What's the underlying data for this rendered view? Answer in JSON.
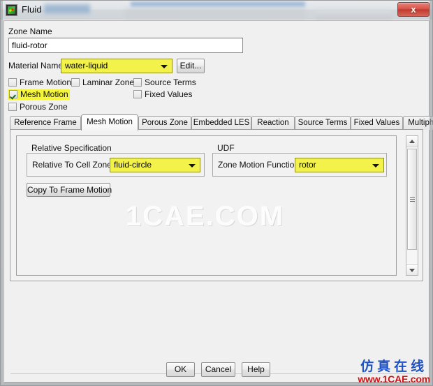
{
  "window": {
    "title": "Fluid",
    "icon": "fluent-app-icon",
    "close_label": "x"
  },
  "form": {
    "zone_name_label": "Zone Name",
    "zone_name_value": "fluid-rotor",
    "material_name_label": "Material Name",
    "material_name_value": "water-liquid",
    "edit_button": "Edit..."
  },
  "checkboxes": [
    {
      "label": "Frame Motion",
      "checked": false,
      "highlighted": false
    },
    {
      "label": "Laminar Zone",
      "checked": false,
      "highlighted": false
    },
    {
      "label": "Source Terms",
      "checked": false,
      "highlighted": false
    },
    {
      "label": "Mesh Motion",
      "checked": true,
      "highlighted": true
    },
    {
      "label": "Fixed Values",
      "checked": false,
      "highlighted": false
    },
    {
      "label": "Porous Zone",
      "checked": false,
      "highlighted": false
    }
  ],
  "tabs": [
    {
      "label": "Reference Frame",
      "active": false
    },
    {
      "label": "Mesh Motion",
      "active": true
    },
    {
      "label": "Porous Zone",
      "active": false
    },
    {
      "label": "Embedded LES",
      "active": false
    },
    {
      "label": "Reaction",
      "active": false
    },
    {
      "label": "Source Terms",
      "active": false
    },
    {
      "label": "Fixed Values",
      "active": false
    },
    {
      "label": "Multiphase",
      "active": false
    }
  ],
  "panel": {
    "relative_spec_title": "Relative Specification",
    "relative_to_cell_zone_label": "Relative To Cell Zone",
    "relative_to_cell_zone_value": "fluid-circle",
    "copy_to_frame_motion_button": "Copy To Frame Motion",
    "udf_title": "UDF",
    "zone_motion_function_label": "Zone Motion Function",
    "zone_motion_function_value": "rotor"
  },
  "footer": {
    "ok_label": "OK",
    "cancel_label": "Cancel",
    "help_label": "Help"
  },
  "watermarks": {
    "center": "1CAE.COM",
    "brand_cn": "仿真在线",
    "brand_url": "www.1CAE.com"
  },
  "colors": {
    "highlight_yellow": "#f2f24a",
    "close_red": "#c13a2e",
    "brand_blue": "#1f52c4",
    "brand_red": "#d31010"
  }
}
